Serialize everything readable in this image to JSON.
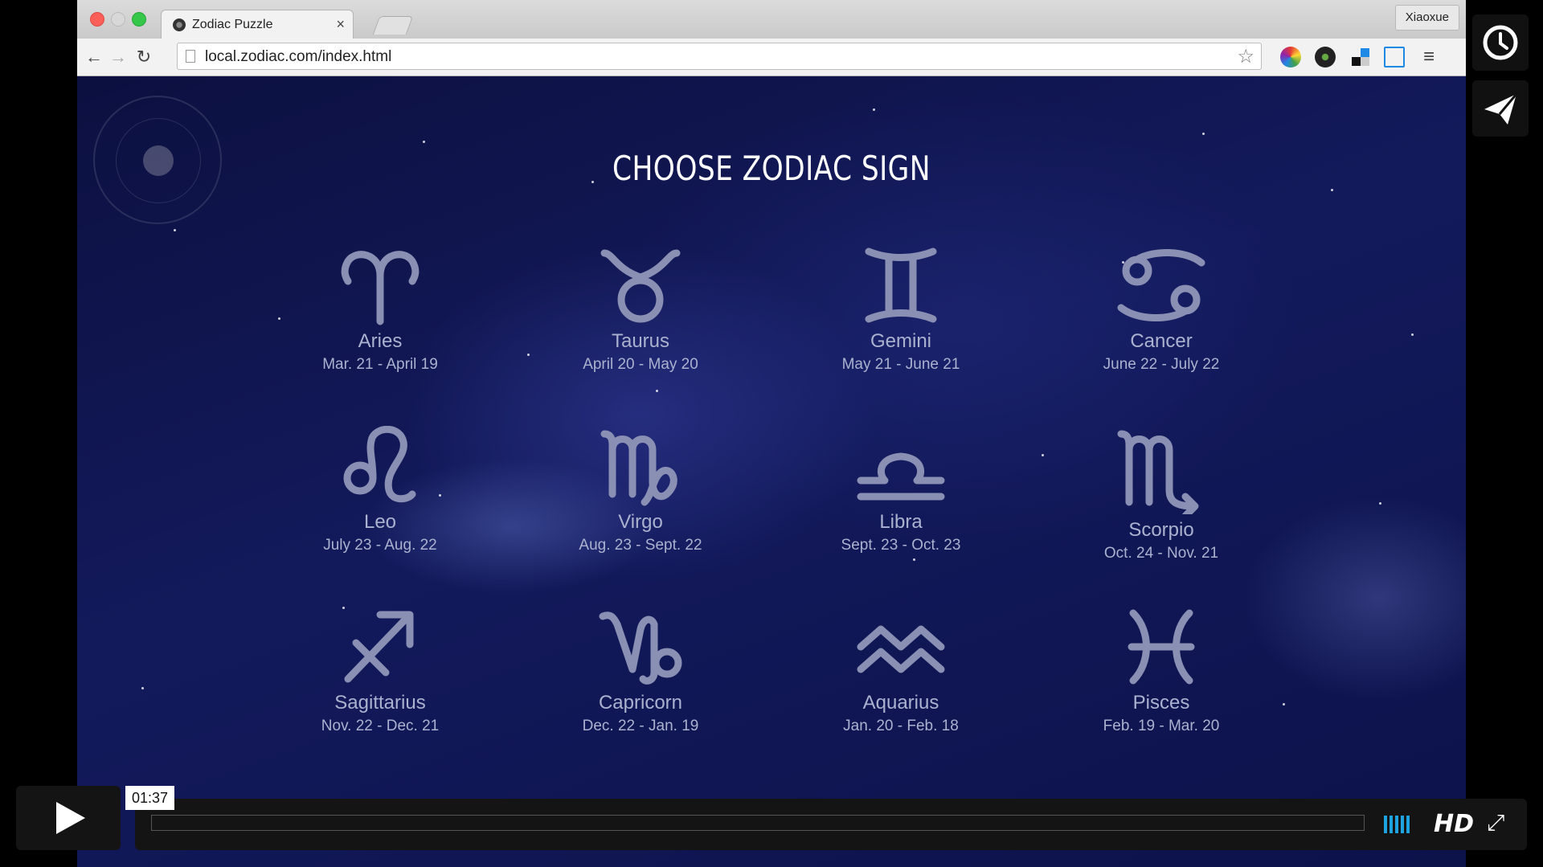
{
  "browser": {
    "tab_title": "Zodiac Puzzle",
    "tab_close": "×",
    "url": "local.zodiac.com/index.html",
    "profile_name": "Xiaoxue"
  },
  "page": {
    "heading": "CHOOSE ZODIAC SIGN",
    "signs": [
      {
        "name": "Aries",
        "dates": "Mar. 21 - April 19"
      },
      {
        "name": "Taurus",
        "dates": "April 20 - May 20"
      },
      {
        "name": "Gemini",
        "dates": "May 21 - June 21"
      },
      {
        "name": "Cancer",
        "dates": "June 22 - July 22"
      },
      {
        "name": "Leo",
        "dates": "July 23 - Aug. 22"
      },
      {
        "name": "Virgo",
        "dates": "Aug. 23 - Sept. 22"
      },
      {
        "name": "Libra",
        "dates": "Sept. 23 - Oct. 23"
      },
      {
        "name": "Scorpio",
        "dates": "Oct. 24 - Nov. 21"
      },
      {
        "name": "Sagittarius",
        "dates": "Nov. 22 - Dec. 21"
      },
      {
        "name": "Capricorn",
        "dates": "Dec. 22 - Jan. 19"
      },
      {
        "name": "Aquarius",
        "dates": "Jan. 20 - Feb. 18"
      },
      {
        "name": "Pisces",
        "dates": "Feb. 19 - Mar. 20"
      }
    ]
  },
  "player": {
    "time": "01:37",
    "hd_label": "HD"
  }
}
